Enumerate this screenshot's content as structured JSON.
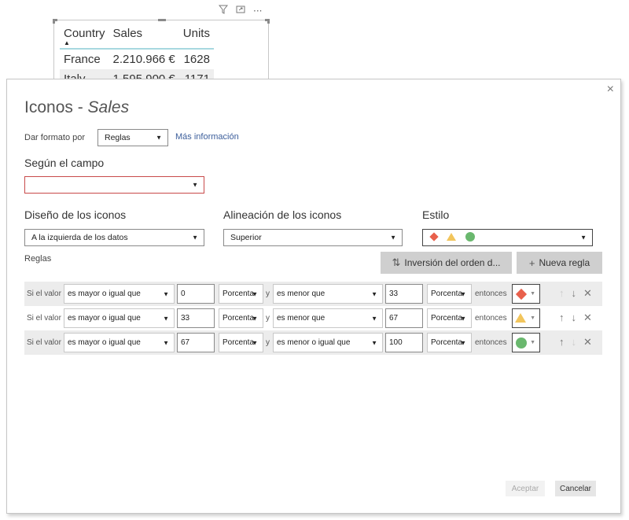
{
  "background_visual": {
    "toolbar_icons": [
      "filter-icon",
      "focus-mode-icon",
      "more-options-icon"
    ],
    "more_label": "···",
    "columns": [
      "Country",
      "Sales",
      "Units"
    ],
    "sort_indicator": "▲",
    "rows": [
      {
        "country": "France",
        "sales": "2.210.966 €",
        "units": "1628"
      },
      {
        "country": "Italy",
        "sales": "1.595.900 €",
        "units": "1171"
      }
    ]
  },
  "dialog": {
    "title_prefix": "Iconos - ",
    "title_field": "Sales",
    "close_label": "×",
    "format_by_label": "Dar formato por",
    "format_by_value": "Reglas",
    "more_info_link": "Más información",
    "based_on_field_label": "Según el campo",
    "based_on_field_value": "",
    "icon_layout_label": "Diseño de los iconos",
    "icon_layout_value": "A la izquierda de los datos",
    "icon_alignment_label": "Alineación de los iconos",
    "icon_alignment_value": "Superior",
    "style_label": "Estilo",
    "style_icons": [
      "red-diamond",
      "yellow-triangle",
      "green-circle"
    ],
    "rules_label": "Reglas",
    "reverse_order_button": "Inversión del orden d...",
    "reverse_icon": "⇅",
    "new_rule_button": "Nueva regla",
    "new_rule_icon": "+",
    "caret": "▼",
    "rules": [
      {
        "if_label": "Si el valor",
        "op1": "es mayor o igual que",
        "val1": "0",
        "type1": "Porcentaje",
        "and_label": "y",
        "op2": "es menor que",
        "val2": "33",
        "type2": "Porcentaje",
        "then_label": "entonces",
        "icon": "red-diamond",
        "up_enabled": false,
        "down_enabled": true
      },
      {
        "if_label": "Si el valor",
        "op1": "es mayor o igual que",
        "val1": "33",
        "type1": "Porcentaje",
        "and_label": "y",
        "op2": "es menor que",
        "val2": "67",
        "type2": "Porcentaje",
        "then_label": "entonces",
        "icon": "yellow-triangle",
        "up_enabled": true,
        "down_enabled": true
      },
      {
        "if_label": "Si el valor",
        "op1": "es mayor o igual que",
        "val1": "67",
        "type1": "Porcentaje",
        "and_label": "y",
        "op2": "es menor o igual que",
        "val2": "100",
        "type2": "Porcentaje",
        "then_label": "entonces",
        "icon": "green-circle",
        "up_enabled": true,
        "down_enabled": false
      }
    ],
    "type_display": "Porcenta",
    "ok_button": "Aceptar",
    "cancel_button": "Cancelar"
  },
  "colors": {
    "red": "#e8604c",
    "yellow": "#f2c55c",
    "green": "#6ab86e",
    "link": "#3c5e9b",
    "error_border": "#c84a4a"
  }
}
